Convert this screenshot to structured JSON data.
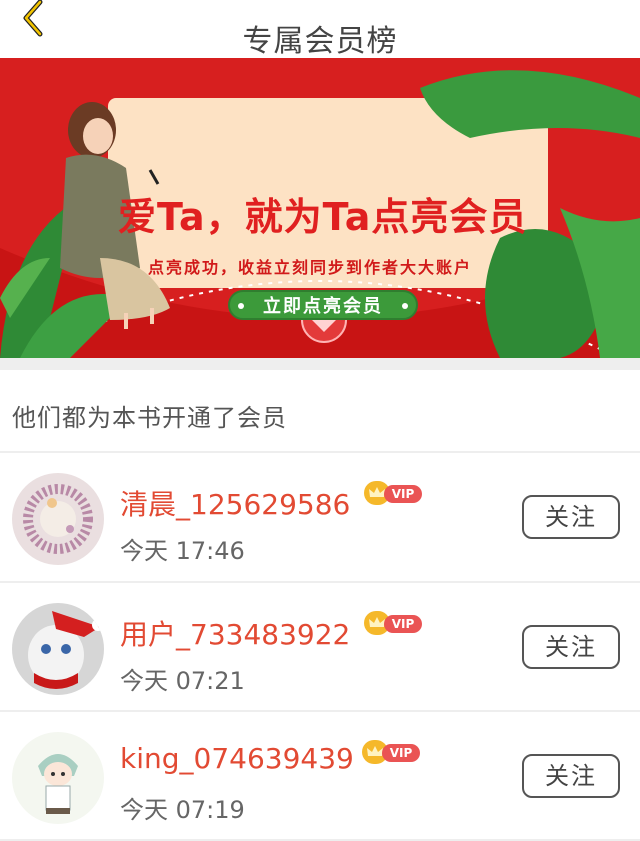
{
  "header": {
    "title": "专属会员榜"
  },
  "banner": {
    "headline": "爱Ta，就为Ta点亮会员",
    "subtitle": "点亮成功，收益立刻同步到作者大大账户",
    "button_label": "立即点亮会员"
  },
  "section": {
    "title": "他们都为本书开通了会员"
  },
  "members": [
    {
      "name": "清晨_125629586",
      "badge": "VIP",
      "time": "今天 17:46",
      "follow_label": "关注"
    },
    {
      "name": "用户_733483922",
      "badge": "VIP",
      "time": "今天 07:21",
      "follow_label": "关注"
    },
    {
      "name": "king_074639439",
      "badge": "VIP",
      "time": "今天 07:19",
      "follow_label": "关注"
    }
  ],
  "colors": {
    "banner_red": "#d71f1f",
    "name_red": "#e24a33",
    "button_green": "#3c9a3a",
    "vip_gold": "#f5b82a",
    "vip_red": "#ea5454"
  },
  "icons": {
    "back": "chevron-left-icon",
    "crown": "crown-icon",
    "heart_seal": "heart-seal-icon"
  }
}
